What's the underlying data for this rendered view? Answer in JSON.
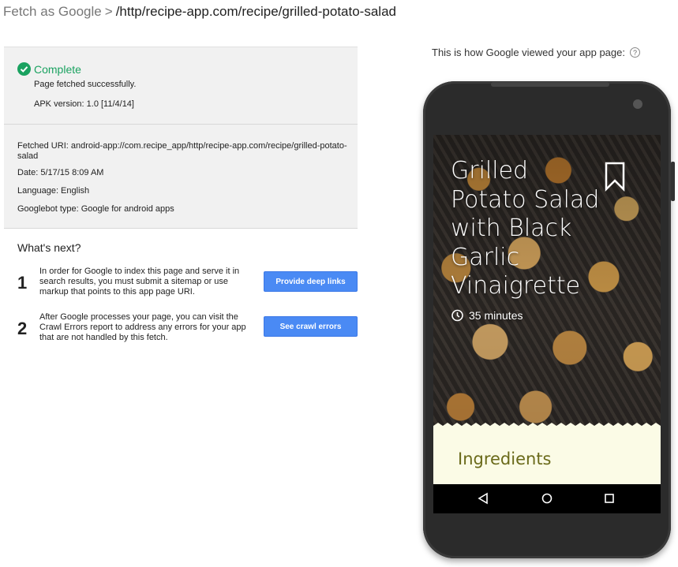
{
  "breadcrumb": {
    "root": "Fetch as Google",
    "separator": ">",
    "url": "/http/recipe-app.com/recipe/grilled-potato-salad"
  },
  "status": {
    "title": "Complete",
    "message": "Page fetched successfully.",
    "apk_version": "APK version: 1.0 [11/4/14]",
    "accent_color": "#1aa260"
  },
  "details": {
    "fetched_uri": "Fetched URI: android-app://com.recipe_app/http/recipe-app.com/recipe/grilled-potato-salad",
    "date": "Date: 5/17/15 8:09 AM",
    "language": "Language: English",
    "googlebot_type": "Googlebot type: Google for android apps"
  },
  "next": {
    "title": "What's next?",
    "steps": [
      {
        "number": "1",
        "text": "In order for Google to index this page and serve it in search results, you must submit a sitemap or use markup that points to this app page URI.",
        "button": "Provide deep links"
      },
      {
        "number": "2",
        "text": "After Google processes your page, you can visit the Crawl Errors report to address any errors for your app that are not handled by this fetch.",
        "button": "See crawl errors"
      }
    ],
    "button_color": "#4a8af4"
  },
  "preview": {
    "caption": "This is how Google viewed your app page:",
    "help_icon": "?",
    "recipe_title": "Grilled Potato Salad with Black Garlic Vinaigrette",
    "cook_time": "35 minutes",
    "section": "Ingredients",
    "icons": [
      "check-circle-icon",
      "help-icon",
      "bookmark-icon",
      "timer-icon",
      "nav-back-icon",
      "nav-home-icon",
      "nav-recents-icon"
    ]
  }
}
